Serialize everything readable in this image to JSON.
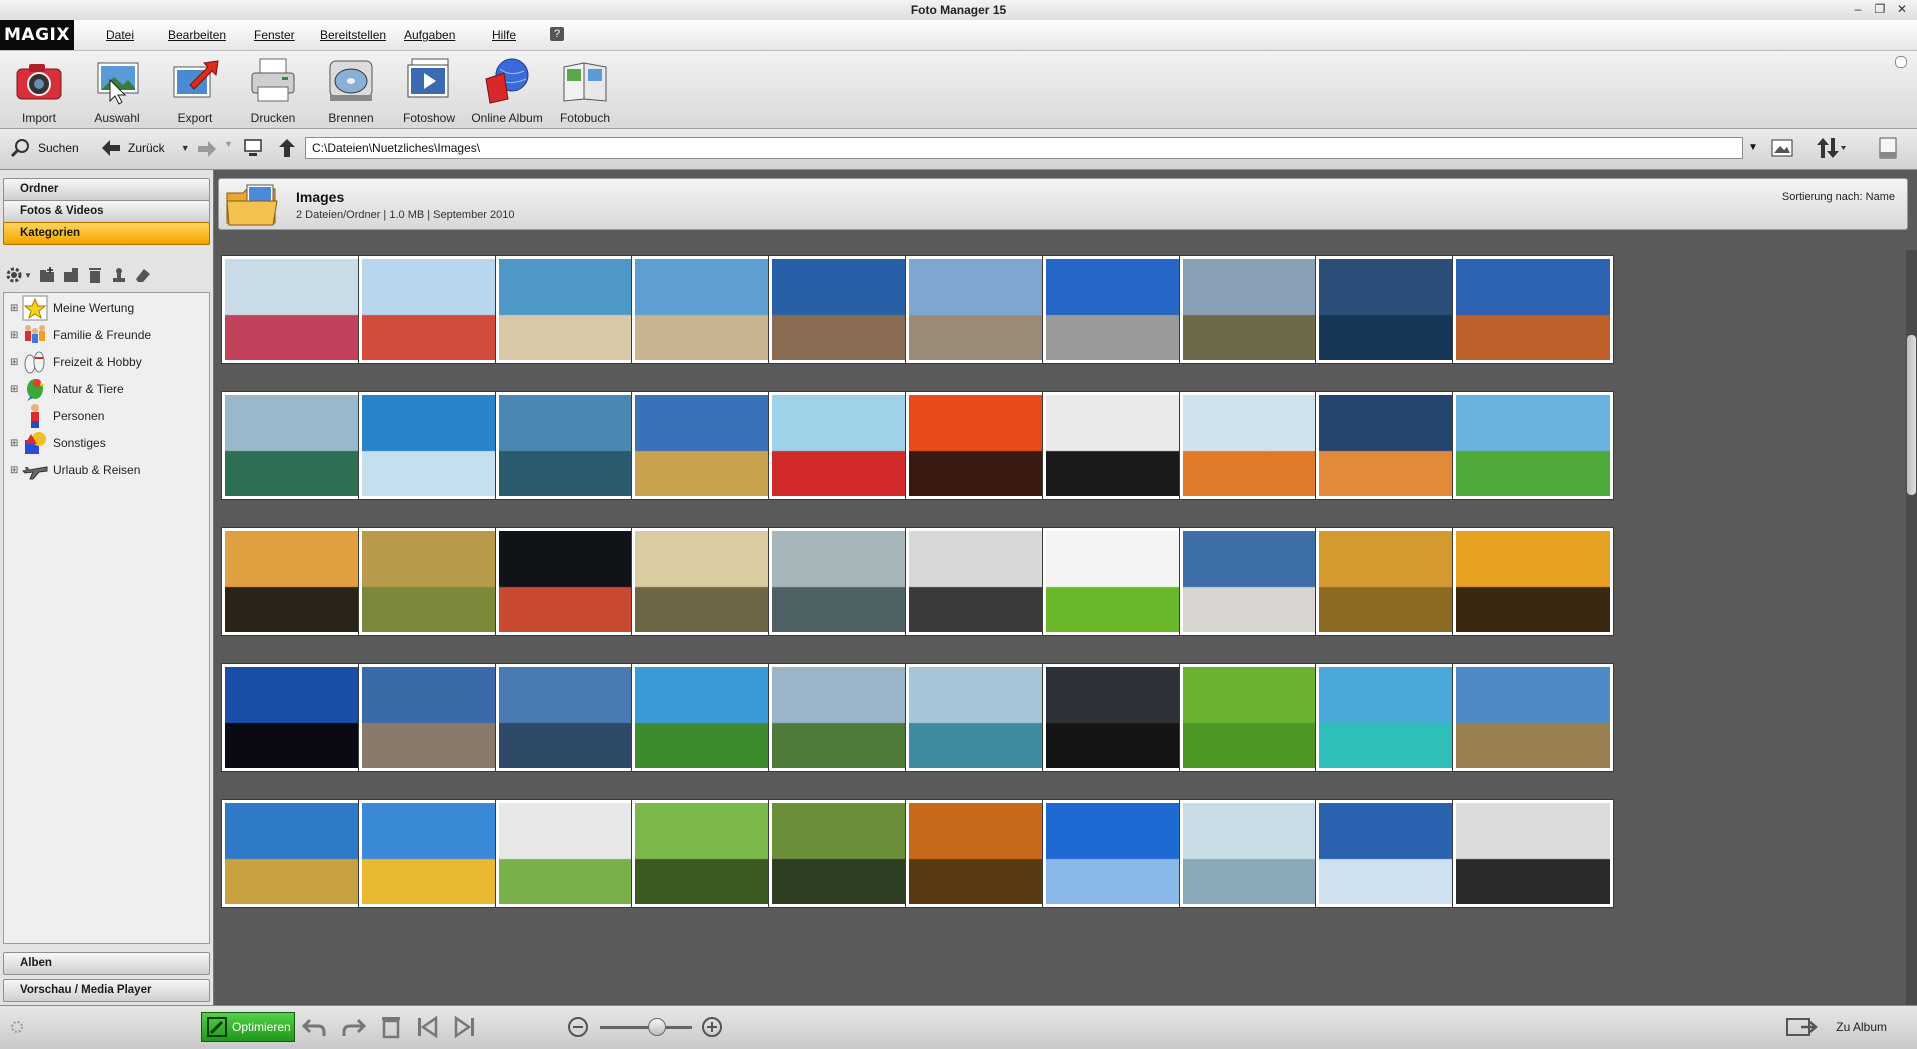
{
  "window": {
    "title": "Foto Manager 15"
  },
  "menu": {
    "logo": "MAGIX",
    "items": [
      "Datei",
      "Bearbeiten",
      "Fenster",
      "Bereitstellen",
      "Aufgaben",
      "Hilfe"
    ]
  },
  "toolbar": {
    "items": [
      {
        "label": "Import",
        "icon": "camera-icon"
      },
      {
        "label": "Auswahl",
        "icon": "selection-icon"
      },
      {
        "label": "Export",
        "icon": "export-icon"
      },
      {
        "label": "Drucken",
        "icon": "printer-icon"
      },
      {
        "label": "Brennen",
        "icon": "burn-disc-icon"
      },
      {
        "label": "Fotoshow",
        "icon": "slideshow-icon"
      },
      {
        "label": "Online Album",
        "icon": "online-album-icon"
      },
      {
        "label": "Fotobuch",
        "icon": "photobook-icon"
      }
    ]
  },
  "nav": {
    "search_label": "Suchen",
    "back_label": "Zurück",
    "path": "C:\\Dateien\\Nuetzliches\\Images\\"
  },
  "left": {
    "sections": {
      "ordner": "Ordner",
      "fotos": "Fotos & Videos",
      "kategorien": "Kategorien",
      "alben": "Alben",
      "vorschau": "Vorschau / Media Player"
    },
    "categories": [
      {
        "label": "Meine Wertung",
        "icon": "star-icon"
      },
      {
        "label": "Familie & Freunde",
        "icon": "family-icon"
      },
      {
        "label": "Freizeit & Hobby",
        "icon": "bowling-icon"
      },
      {
        "label": "Natur & Tiere",
        "icon": "parrot-icon"
      },
      {
        "label": "Personen",
        "icon": "person-icon"
      },
      {
        "label": "Sonstiges",
        "icon": "shapes-icon"
      },
      {
        "label": "Urlaub & Reisen",
        "icon": "airplane-icon"
      }
    ]
  },
  "folder": {
    "name": "Images",
    "info": "2 Dateien/Ordner | 1.0 MB | September 2010",
    "sort": "Sortierung nach: Name"
  },
  "colors": {
    "accent_active": "#f0a600",
    "optimize_green": "#2aa822",
    "background": "#5a5a5a"
  },
  "bottom": {
    "optimize_label": "Optimieren",
    "to_album_label": "Zu Album",
    "zoom_level": 0.5
  },
  "thumbnails": [
    {
      "name": "girls-tulips",
      "sky": "#c8dbe6",
      "ground": "#c1425a"
    },
    {
      "name": "woman-pinwheel",
      "sky": "#b8d6ee",
      "ground": "#d24b3c"
    },
    {
      "name": "dog-beach",
      "sky": "#4e98c8",
      "ground": "#d8c8a6"
    },
    {
      "name": "jumping-beach",
      "sky": "#5d9fd2",
      "ground": "#c9b490"
    },
    {
      "name": "man-pier",
      "sky": "#2860a8",
      "ground": "#8a6c52"
    },
    {
      "name": "rocks-clouds",
      "sky": "#7fa6cf",
      "ground": "#9a8c78"
    },
    {
      "name": "woman-rock",
      "sky": "#2566c6",
      "ground": "#9a9a9a"
    },
    {
      "name": "hills-hiker",
      "sky": "#8aa0b6",
      "ground": "#6c6a48"
    },
    {
      "name": "sailboat",
      "sky": "#2a4e78",
      "ground": "#163658"
    },
    {
      "name": "motorbike-desert",
      "sky": "#2d63b2",
      "ground": "#c0602a"
    },
    {
      "name": "mountain-lake",
      "sky": "#9ab7cc",
      "ground": "#2e6e52"
    },
    {
      "name": "glacier-blue",
      "sky": "#2a82c8",
      "ground": "#c4dff0"
    },
    {
      "name": "fjord-reflection",
      "sky": "#4c86b2",
      "ground": "#2a5a6e"
    },
    {
      "name": "sky-field",
      "sky": "#3a72b8",
      "ground": "#c8a24c"
    },
    {
      "name": "red-flowers",
      "sky": "#9fd2e8",
      "ground": "#d22a2a"
    },
    {
      "name": "sunset-red",
      "sky": "#e84a1c",
      "ground": "#3a1a10"
    },
    {
      "name": "tree-bench",
      "sky": "#eaeaea",
      "ground": "#1a1a1a"
    },
    {
      "name": "suitcase-beach",
      "sky": "#cfe3ef",
      "ground": "#e07a2a"
    },
    {
      "name": "palm-sunset",
      "sky": "#24466e",
      "ground": "#e28a3a"
    },
    {
      "name": "windmill-canal",
      "sky": "#6ab2e0",
      "ground": "#4ea83a"
    },
    {
      "name": "rider-sunset",
      "sky": "#e0a040",
      "ground": "#2a2418"
    },
    {
      "name": "girl-grass",
      "sky": "#b89a4a",
      "ground": "#7a8a3a"
    },
    {
      "name": "dark-window",
      "sky": "#101418",
      "ground": "#c84a30"
    },
    {
      "name": "arch-bridge",
      "sky": "#d8cca0",
      "ground": "#6e6644"
    },
    {
      "name": "woman-sea",
      "sky": "#a6b6ba",
      "ground": "#4e6266"
    },
    {
      "name": "umbrella-beach",
      "sky": "#d8d8d8",
      "ground": "#3a3a3a"
    },
    {
      "name": "woman-apple",
      "sky": "#f4f4f4",
      "ground": "#6ab82a"
    },
    {
      "name": "woman-clouds",
      "sky": "#3e6ea8",
      "ground": "#d8d4d0"
    },
    {
      "name": "golden-walk",
      "sky": "#d49a30",
      "ground": "#8c6a22"
    },
    {
      "name": "sunset-dancer",
      "sky": "#e6a220",
      "ground": "#3a2810"
    },
    {
      "name": "clouds-silhouettes",
      "sky": "#1a4ea8",
      "ground": "#0a0a14"
    },
    {
      "name": "snow-mountains",
      "sky": "#3a6aa8",
      "ground": "#8a7a6a"
    },
    {
      "name": "blue-mountains",
      "sky": "#4a7ab2",
      "ground": "#2e4a68"
    },
    {
      "name": "windmills",
      "sky": "#3a9ad8",
      "ground": "#3e8a2e"
    },
    {
      "name": "chapel-mountain",
      "sky": "#9ab4ca",
      "ground": "#4e7a3a"
    },
    {
      "name": "coast-village",
      "sky": "#a6c6d8",
      "ground": "#3e8aa0"
    },
    {
      "name": "horse-silhouette",
      "sky": "#2e3238",
      "ground": "#141414"
    },
    {
      "name": "green-field-cross",
      "sky": "#6ab230",
      "ground": "#4e9626"
    },
    {
      "name": "tropical-bay",
      "sky": "#4aa8d8",
      "ground": "#2ec0b8"
    },
    {
      "name": "red-umbrellas",
      "sky": "#4e8ac8",
      "ground": "#9a8050"
    },
    {
      "name": "wind-turbines",
      "sky": "#2e7ac8",
      "ground": "#c8a240"
    },
    {
      "name": "hot-air-balloon",
      "sky": "#3a8ad8",
      "ground": "#e8b830"
    },
    {
      "name": "woman-lake",
      "sky": "#e8e8e8",
      "ground": "#7ab04a"
    },
    {
      "name": "forest-path",
      "sky": "#7ab84a",
      "ground": "#3a5a22"
    },
    {
      "name": "bridge-forest",
      "sky": "#6a8e3a",
      "ground": "#2e3e22"
    },
    {
      "name": "autumn-woman",
      "sky": "#c86a1a",
      "ground": "#5a3a12"
    },
    {
      "name": "sky-jump",
      "sky": "#1e6ad2",
      "ground": "#8ab8e8"
    },
    {
      "name": "ice-cave",
      "sky": "#c8dce6",
      "ground": "#8aa8b8"
    },
    {
      "name": "sail-blue",
      "sky": "#2a62b0",
      "ground": "#cfe0ee"
    },
    {
      "name": "windmill-bw",
      "sky": "#dcdcdc",
      "ground": "#2a2a2a"
    }
  ]
}
